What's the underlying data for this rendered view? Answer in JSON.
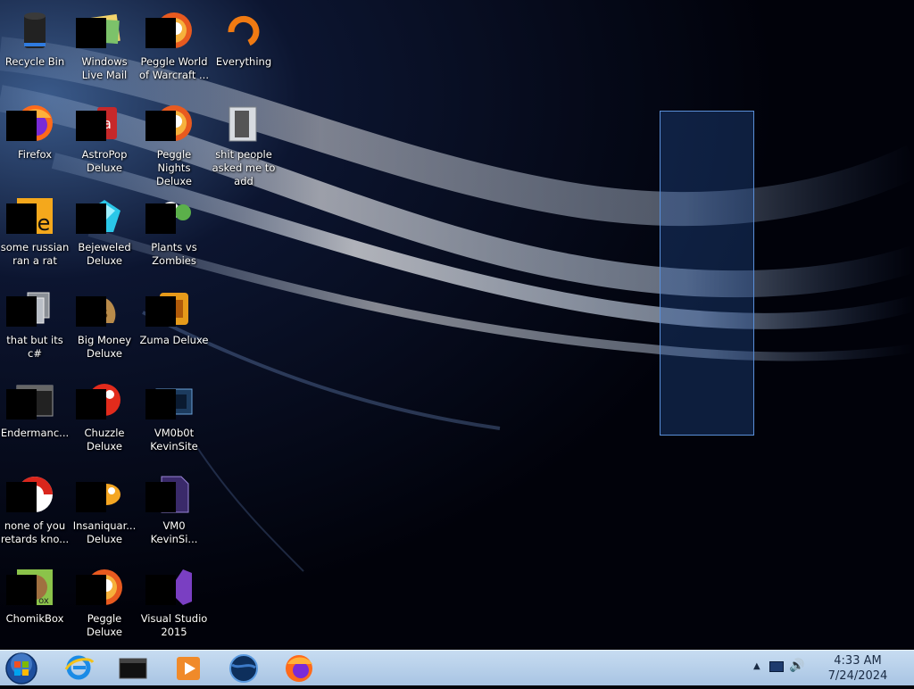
{
  "desktop": {
    "icons": [
      {
        "id": "recycle-bin",
        "label": "Recycle Bin",
        "glyph": "bin"
      },
      {
        "id": "windows-live-mail",
        "label": "Windows Live Mail",
        "glyph": "mail"
      },
      {
        "id": "peggle-world-of-warcraft",
        "label": "Peggle World of Warcraft ...",
        "glyph": "peggle"
      },
      {
        "id": "everything",
        "label": "Everything",
        "glyph": "everything"
      },
      {
        "id": "firefox",
        "label": "Firefox",
        "glyph": "firefox"
      },
      {
        "id": "astropop-deluxe",
        "label": "AstroPop Deluxe",
        "glyph": "astropop"
      },
      {
        "id": "peggle-nights-deluxe",
        "label": "Peggle Nights Deluxe",
        "glyph": "peggle"
      },
      {
        "id": "shit-people-asked-me-to-add",
        "label": "shit people asked me to add",
        "glyph": "folder"
      },
      {
        "id": "some-russian-ran-a-rat",
        "label": "some russian ran a rat",
        "glyph": "russian"
      },
      {
        "id": "bejeweled-deluxe",
        "label": "Bejeweled Deluxe",
        "glyph": "gem"
      },
      {
        "id": "plants-vs-zombies",
        "label": "Plants vs Zombies",
        "glyph": "plants"
      },
      {
        "id": "that-but-its-csharp",
        "label": "that but its c#",
        "glyph": "copy"
      },
      {
        "id": "big-money-deluxe",
        "label": "Big Money Deluxe",
        "glyph": "money"
      },
      {
        "id": "zuma-deluxe",
        "label": "Zuma Deluxe",
        "glyph": "zuma"
      },
      {
        "id": "endermanch",
        "label": "Endermanc...",
        "glyph": "terminal"
      },
      {
        "id": "chuzzle-deluxe",
        "label": "Chuzzle Deluxe",
        "glyph": "chuzzle"
      },
      {
        "id": "vm0b0t-kevinsite",
        "label": "VM0b0t KevinSite",
        "glyph": "vm"
      },
      {
        "id": "none-of-you-retards-kno",
        "label": "none of you retards kno...",
        "glyph": "redball"
      },
      {
        "id": "insaniquarium-deluxe",
        "label": "Insaniquar... Deluxe",
        "glyph": "fish"
      },
      {
        "id": "vm0-kevinsi",
        "label": "VM0 KevinSi...",
        "glyph": "file"
      },
      {
        "id": "chomikbox",
        "label": "ChomikBox",
        "glyph": "chomik"
      },
      {
        "id": "peggle-deluxe",
        "label": "Peggle Deluxe",
        "glyph": "peggle"
      },
      {
        "id": "visual-studio-2015",
        "label": "Visual Studio 2015",
        "glyph": "vs"
      }
    ]
  },
  "taskbar": {
    "pinned": [
      {
        "id": "internet-explorer",
        "glyph": "ie"
      },
      {
        "id": "cmd-window",
        "glyph": "cmd"
      },
      {
        "id": "media-player",
        "glyph": "media"
      },
      {
        "id": "globe-app",
        "glyph": "globe"
      },
      {
        "id": "firefox-taskbar",
        "glyph": "firefox"
      }
    ],
    "clock": {
      "time": "4:33 AM",
      "date": "7/24/2024"
    }
  },
  "colors": {
    "taskbar_top": "#c7dcf1",
    "taskbar_bottom": "#a8c4e3",
    "selection_border": "#5a8fd8"
  }
}
